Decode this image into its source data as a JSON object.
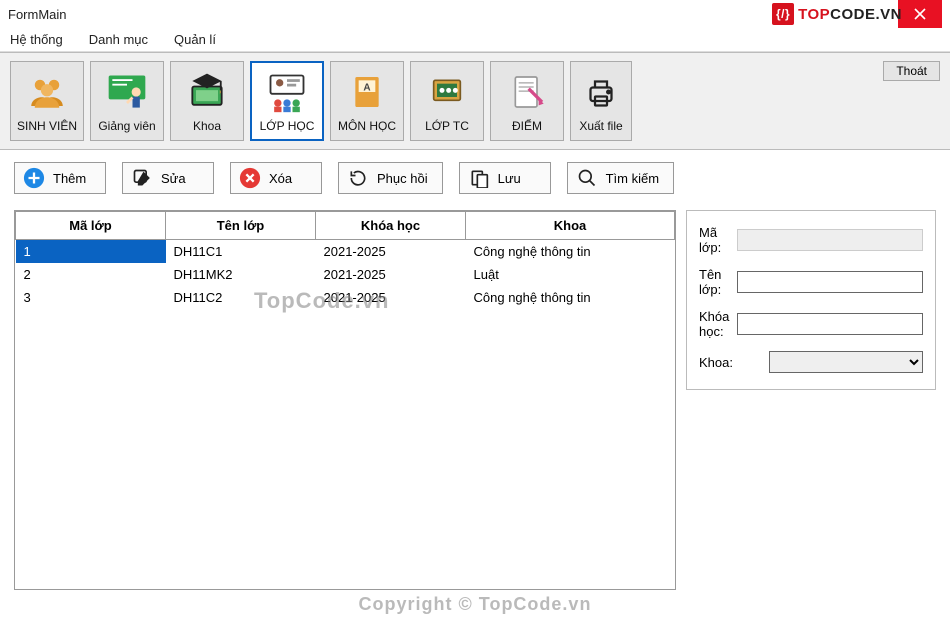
{
  "window": {
    "title": "FormMain"
  },
  "brand": {
    "prefix": "TOP",
    "suffix": "CODE.VN",
    "badge": "{/}"
  },
  "menubar": [
    "Hệ thống",
    "Danh mục",
    "Quản lí"
  ],
  "toolbar": {
    "items": [
      {
        "id": "sinhvien",
        "label": "SINH VIÊN"
      },
      {
        "id": "giangvien",
        "label": "Giảng viên"
      },
      {
        "id": "khoa",
        "label": "Khoa"
      },
      {
        "id": "lophoc",
        "label": "LỚP HỌC",
        "selected": true
      },
      {
        "id": "monhoc",
        "label": "MÔN HỌC"
      },
      {
        "id": "loptc",
        "label": "LỚP TC"
      },
      {
        "id": "diem",
        "label": "ĐIỂM"
      },
      {
        "id": "xuatfile",
        "label": "Xuất file"
      }
    ],
    "logout": "Thoát"
  },
  "actions": {
    "add": "Thêm",
    "edit": "Sửa",
    "delete": "Xóa",
    "restore": "Phục hồi",
    "save": "Lưu",
    "search": "Tìm kiếm"
  },
  "grid": {
    "columns": [
      "Mã lớp",
      "Tên lớp",
      "Khóa học",
      "Khoa"
    ],
    "rows": [
      {
        "ma": "1",
        "ten": "DH11C1",
        "khoahoc": "2021-2025",
        "khoa": "Công nghệ thông tin",
        "selected": true
      },
      {
        "ma": "2",
        "ten": "DH11MK2",
        "khoahoc": "2021-2025",
        "khoa": "Luật"
      },
      {
        "ma": "3",
        "ten": "DH11C2",
        "khoahoc": "2021-2025",
        "khoa": "Công nghệ thông tin"
      }
    ]
  },
  "form": {
    "labels": {
      "ma": "Mã lớp:",
      "ten": "Tên lớp:",
      "khoahoc": "Khóa học:",
      "khoa": "Khoa:"
    },
    "values": {
      "ma": "",
      "ten": "",
      "khoahoc": "",
      "khoa": ""
    }
  },
  "watermarks": {
    "inline": "TopCode.vn",
    "footer": "Copyright © TopCode.vn"
  }
}
